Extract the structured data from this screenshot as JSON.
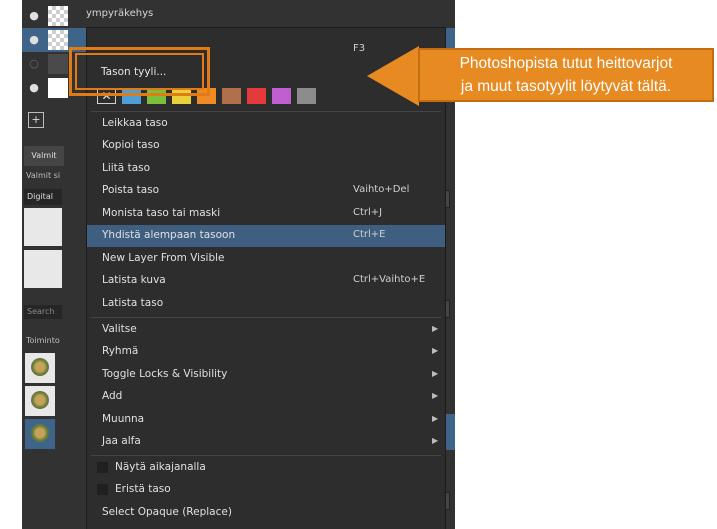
{
  "layers": [
    {
      "name": "ympyräkehys"
    },
    {
      "name": ""
    },
    {
      "name": ""
    },
    {
      "name": ""
    }
  ],
  "left_panel": {
    "tab": "Valmit",
    "label1": "Valmit si",
    "combo": "Digital",
    "search": "Search",
    "history_label": "Toiminto"
  },
  "menu": {
    "f3_shortcut": "F3",
    "layer_style": "Tason tyyli...",
    "swatch_none": "✕",
    "swatch_colors": [
      "#4f9fd6",
      "#7cbf3c",
      "#e8d23a",
      "#f08a24",
      "#b0704c",
      "#e53a3a",
      "#c060d0",
      "#8c8c8c"
    ],
    "items": [
      {
        "label": "Leikkaa taso",
        "shortcut": ""
      },
      {
        "label": "Kopioi taso",
        "shortcut": ""
      },
      {
        "label": "Liitä taso",
        "shortcut": ""
      },
      {
        "label": "Poista taso",
        "shortcut": "Vaihto+Del"
      },
      {
        "label": "Monista taso tai maski",
        "shortcut": "Ctrl+J"
      },
      {
        "label": "Yhdistä alempaan tasoon",
        "shortcut": "Ctrl+E",
        "highlighted": true
      },
      {
        "label": "New Layer From Visible",
        "shortcut": ""
      },
      {
        "label": "Latista kuva",
        "shortcut": "Ctrl+Vaihto+E"
      },
      {
        "label": "Latista taso",
        "shortcut": ""
      },
      {
        "label": "Valitse",
        "submenu": true
      },
      {
        "label": "Ryhmä",
        "submenu": true
      },
      {
        "label": "Toggle Locks & Visibility",
        "submenu": true
      },
      {
        "label": "Add",
        "submenu": true
      },
      {
        "label": "Muunna",
        "submenu": true
      },
      {
        "label": "Jaa alfa",
        "submenu": true
      },
      {
        "label": "Näytä aikajanalla",
        "checkbox": true
      },
      {
        "label": "Eristä taso",
        "checkbox": true
      },
      {
        "label": "Select Opaque (Replace)"
      }
    ]
  },
  "callout": {
    "line1": "Photoshopista tutut heittovarjot",
    "line2": "ja muut tasotyylit löytyvät tältä."
  },
  "colors": {
    "accent_orange": "#e68a21",
    "highlight_blue": "#3e5f80",
    "panel_bg": "#323232"
  }
}
